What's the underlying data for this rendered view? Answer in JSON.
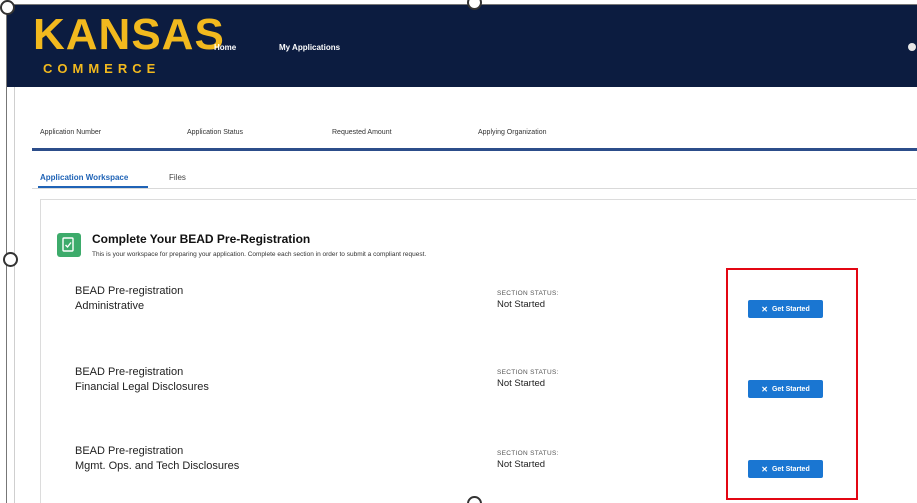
{
  "header": {
    "logo_main": "KANSAS",
    "logo_sub": "COMMERCE",
    "nav": [
      "Home",
      "My Applications"
    ],
    "bg_color": "#0c1c40",
    "logo_color": "#f2b91e"
  },
  "fields": [
    "Application Number",
    "Application Status",
    "Requested Amount",
    "Applying Organization"
  ],
  "tabs": {
    "active": "Application Workspace",
    "other": "Files"
  },
  "card": {
    "icon": "checklist-icon",
    "title": "Complete Your BEAD Pre-Registration",
    "subtitle": "This is your workspace for preparing your application.  Complete each section in order to submit a compliant request."
  },
  "sections": [
    {
      "line1": "BEAD Pre-registration",
      "line2": "Administrative",
      "status_label": "SECTION STATUS:",
      "status": "Not Started",
      "button": "Get Started"
    },
    {
      "line1": "BEAD Pre-registration",
      "line2": "Financial Legal Disclosures",
      "status_label": "SECTION STATUS:",
      "status": "Not Started",
      "button": "Get Started"
    },
    {
      "line1": "BEAD Pre-registration",
      "line2": "Mgmt. Ops. and Tech Disclosures",
      "status_label": "SECTION STATUS:",
      "status": "Not Started",
      "button": "Get Started"
    }
  ],
  "colors": {
    "accent": "#1a76d2",
    "highlight": "#e30613",
    "tab_active": "#1f63b6"
  }
}
